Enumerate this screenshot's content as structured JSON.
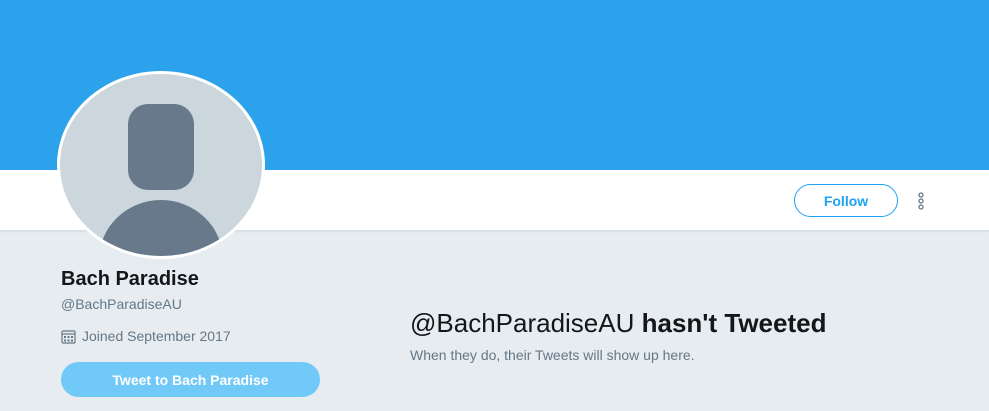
{
  "profile": {
    "name": "Bach Paradise",
    "handle": "@BachParadiseAU",
    "joined": "Joined September 2017",
    "tweet_to_label": "Tweet to Bach Paradise"
  },
  "actions": {
    "follow_label": "Follow",
    "more_icon": "more-vertical-icon"
  },
  "empty_state": {
    "handle": "@BachParadiseAU",
    "title_suffix": "hasn't Tweeted",
    "subtitle": "When they do, their Tweets will show up here."
  },
  "colors": {
    "banner": "#2ca2ec",
    "accent": "#1da1f2",
    "tweet_button": "#71c9f8",
    "page_background": "#e6ecf0",
    "secondary_text": "#657786"
  },
  "icons": {
    "avatar": "default-avatar-icon",
    "calendar": "calendar-icon"
  }
}
